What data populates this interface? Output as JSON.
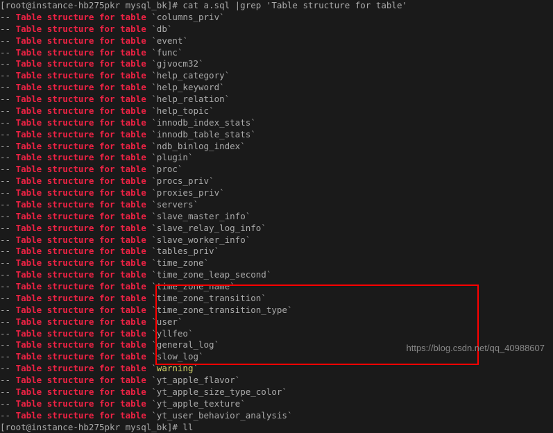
{
  "prompt1": "[root@instance-hb275pkr mysql_bk]# cat a.sql |grep 'Table structure for table'",
  "prompt2": "[root@instance-hb275pkr mysql_bk]# ll",
  "prefix": "-- ",
  "match_text": "Table structure for table",
  "watermark": "https://blog.csdn.net/qq_40988607",
  "tables": [
    {
      "name": "columns_priv",
      "hl": false
    },
    {
      "name": "db",
      "hl": false
    },
    {
      "name": "event",
      "hl": false
    },
    {
      "name": "func",
      "hl": false
    },
    {
      "name": "gjvocm32",
      "hl": false
    },
    {
      "name": "help_category",
      "hl": false
    },
    {
      "name": "help_keyword",
      "hl": false
    },
    {
      "name": "help_relation",
      "hl": false
    },
    {
      "name": "help_topic",
      "hl": false
    },
    {
      "name": "innodb_index_stats",
      "hl": false
    },
    {
      "name": "innodb_table_stats",
      "hl": false
    },
    {
      "name": "ndb_binlog_index",
      "hl": false
    },
    {
      "name": "plugin",
      "hl": false
    },
    {
      "name": "proc",
      "hl": false
    },
    {
      "name": "procs_priv",
      "hl": false
    },
    {
      "name": "proxies_priv",
      "hl": false
    },
    {
      "name": "servers",
      "hl": false
    },
    {
      "name": "slave_master_info",
      "hl": false
    },
    {
      "name": "slave_relay_log_info",
      "hl": false
    },
    {
      "name": "slave_worker_info",
      "hl": false
    },
    {
      "name": "tables_priv",
      "hl": false
    },
    {
      "name": "time_zone",
      "hl": false
    },
    {
      "name": "time_zone_leap_second",
      "hl": false
    },
    {
      "name": "time_zone_name",
      "hl": false
    },
    {
      "name": "time_zone_transition",
      "hl": false
    },
    {
      "name": "time_zone_transition_type",
      "hl": false
    },
    {
      "name": "user",
      "hl": false
    },
    {
      "name": "yllfeo",
      "hl": false
    },
    {
      "name": "general_log",
      "hl": false
    },
    {
      "name": "slow_log",
      "hl": false
    },
    {
      "name": "warning",
      "hl": true
    },
    {
      "name": "yt_apple_flavor",
      "hl": false
    },
    {
      "name": "yt_apple_size_type_color",
      "hl": false
    },
    {
      "name": "yt_apple_texture",
      "hl": false
    },
    {
      "name": "yt_user_behavior_analysis",
      "hl": false
    }
  ]
}
